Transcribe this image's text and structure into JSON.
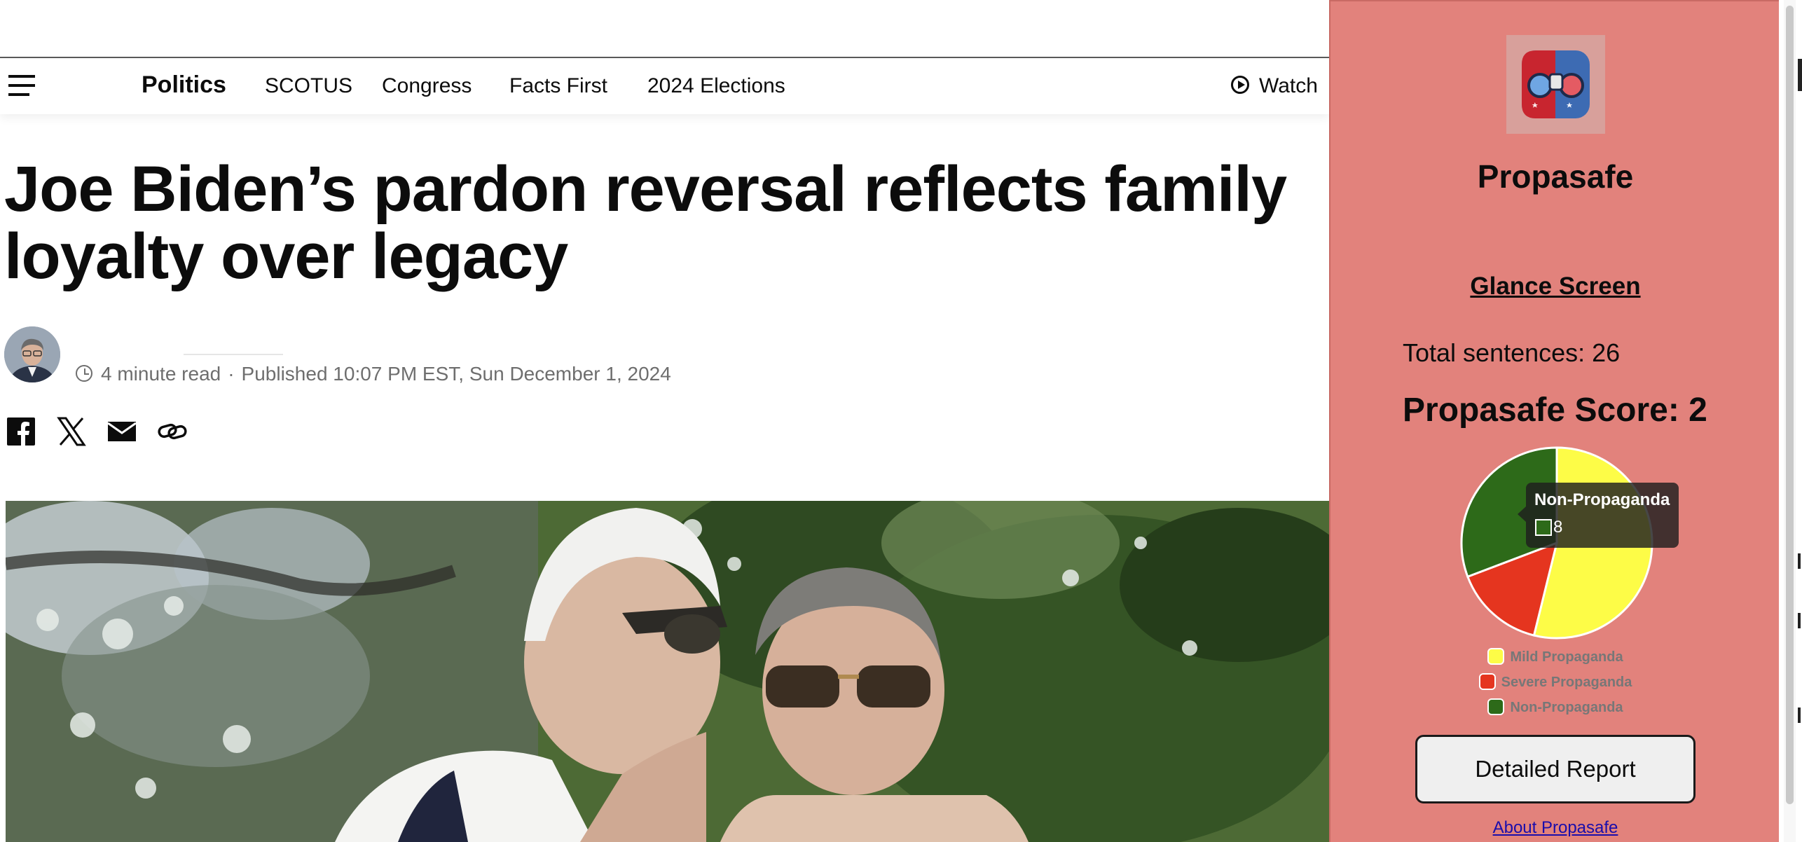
{
  "nav": {
    "items": [
      "Politics",
      "SCOTUS",
      "Congress",
      "Facts First",
      "2024 Elections"
    ],
    "watch_label": "Watch"
  },
  "article": {
    "headline_line1": "Joe Biden’s pardon reversal reflects family",
    "headline_line2": "loyalty over legacy",
    "read_time": "4 minute read",
    "separator": "·",
    "published": "Published 10:07 PM EST, Sun December 1, 2024",
    "share_icons": [
      "facebook-icon",
      "x-icon",
      "email-icon",
      "link-icon"
    ]
  },
  "extension": {
    "name": "Propasafe",
    "glance_title": "Glance Screen",
    "total_sentences": "Total sentences: 26",
    "score": "Propasafe Score: 2",
    "tooltip": {
      "title": "Non-Propaganda",
      "value": "8"
    },
    "detailed_report_label": "Detailed Report",
    "about_link": "About Propasafe",
    "colors": {
      "panel_bg": "#e2827c",
      "mild": "#fdfc47",
      "severe": "#e5351f",
      "non": "#2d6a19"
    }
  },
  "chart_data": {
    "type": "pie",
    "categories": [
      "Mild Propaganda",
      "Severe Propaganda",
      "Non-Propaganda"
    ],
    "values": [
      14,
      4,
      8
    ],
    "colors": [
      "#fdfc47",
      "#e5351f",
      "#2d6a19"
    ],
    "legend_position": "bottom"
  }
}
